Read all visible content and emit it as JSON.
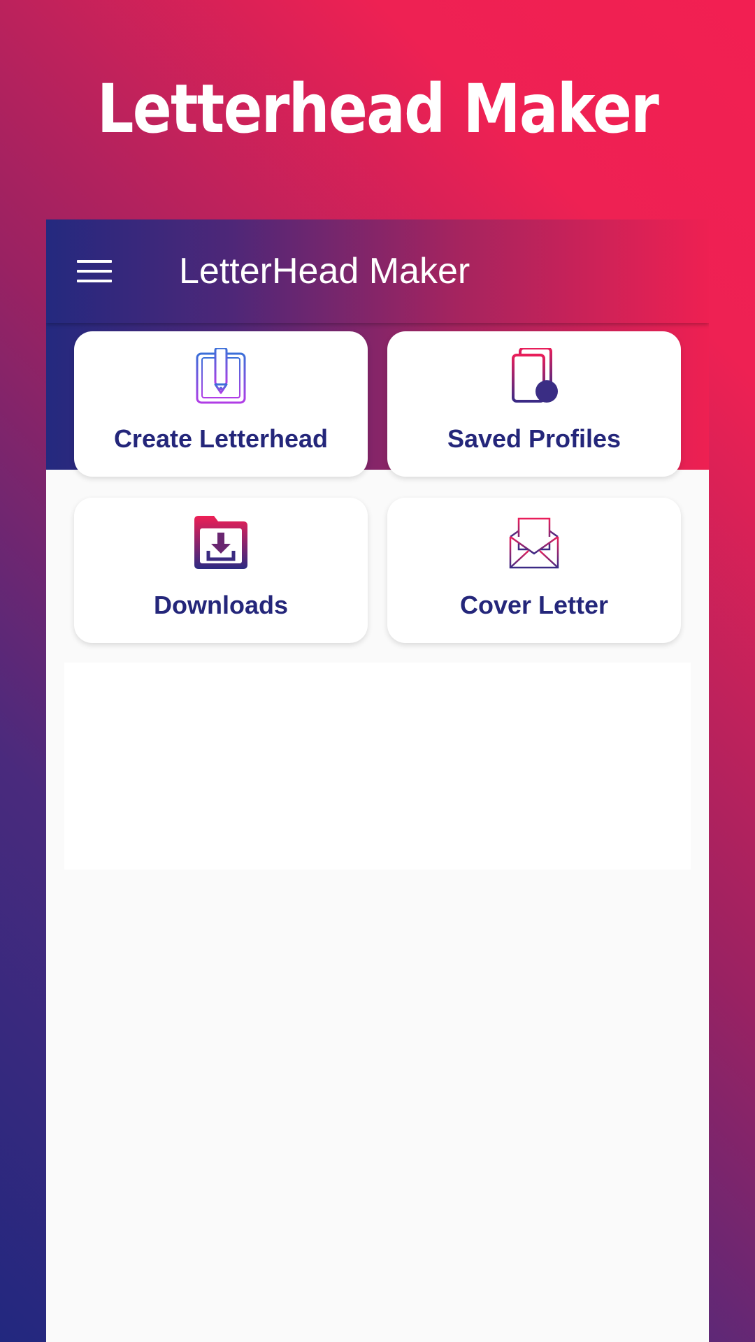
{
  "promo": {
    "title": "Letterhead Maker"
  },
  "toolbar": {
    "title": "LetterHead Maker"
  },
  "cards": [
    {
      "label": "Create Letterhead",
      "icon": "letterhead-pencil-icon"
    },
    {
      "label": "Saved Profiles",
      "icon": "saved-profiles-icon"
    },
    {
      "label": "Downloads",
      "icon": "download-folder-icon"
    },
    {
      "label": "Cover Letter",
      "icon": "envelope-letter-icon"
    }
  ],
  "colors": {
    "brand_pink": "#ee2052",
    "brand_navy": "#24297f",
    "card_label": "#24267a",
    "surface": "#fafafa"
  }
}
